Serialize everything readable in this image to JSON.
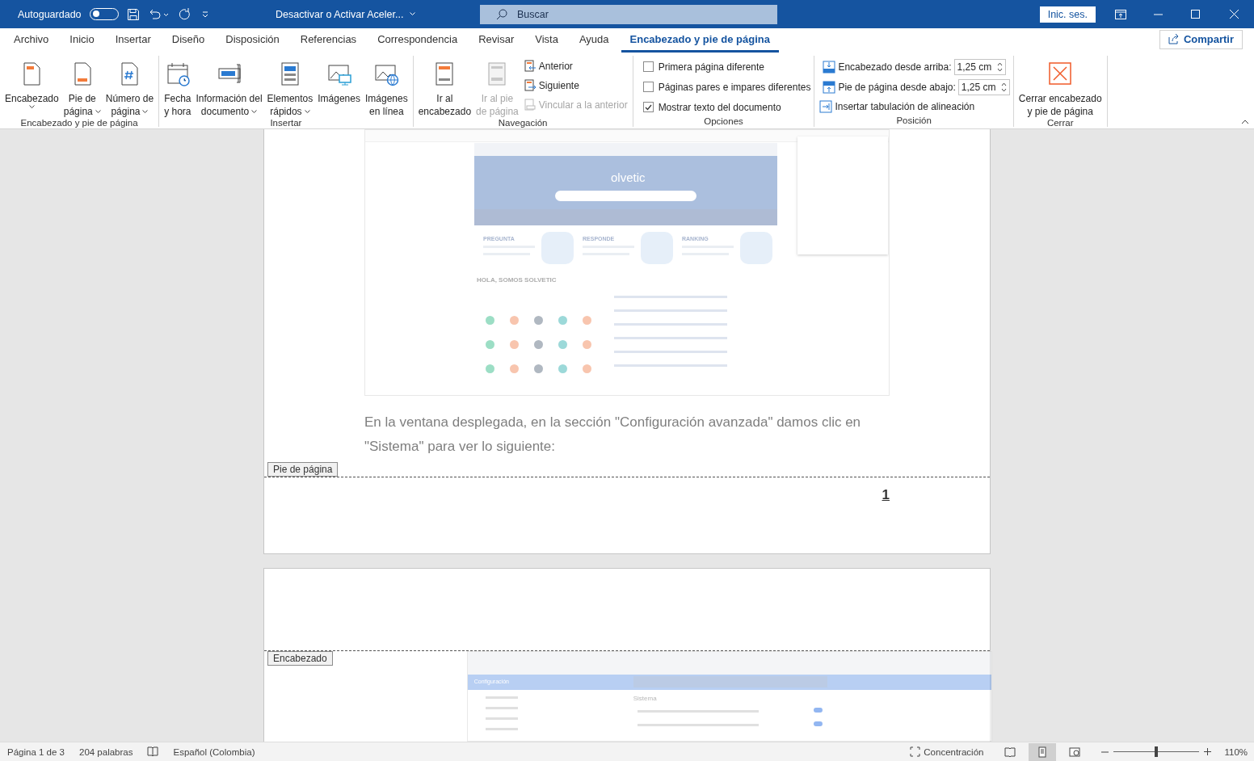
{
  "titlebar": {
    "autosave_label": "Autoguardado",
    "autosave_on": false,
    "doc_title": "Desactivar o Activar Aceler...",
    "search_placeholder": "Buscar",
    "signin": "Inic. ses."
  },
  "menu_tabs": [
    {
      "label": "Archivo",
      "selected": false
    },
    {
      "label": "Inicio",
      "selected": false
    },
    {
      "label": "Insertar",
      "selected": false
    },
    {
      "label": "Diseño",
      "selected": false
    },
    {
      "label": "Disposición",
      "selected": false
    },
    {
      "label": "Referencias",
      "selected": false
    },
    {
      "label": "Correspondencia",
      "selected": false
    },
    {
      "label": "Revisar",
      "selected": false
    },
    {
      "label": "Vista",
      "selected": false
    },
    {
      "label": "Ayuda",
      "selected": false
    },
    {
      "label": "Encabezado y pie de página",
      "selected": true
    }
  ],
  "share": "Compartir",
  "ribbon_groups": [
    {
      "title": "Encabezado y pie de página",
      "items": [
        {
          "kind": "large",
          "lines": [
            "Encabezado"
          ],
          "dropdown": true,
          "disabled": false
        },
        {
          "kind": "large",
          "lines": [
            "Pie de",
            "página"
          ],
          "dropdown": true,
          "disabled": false
        },
        {
          "kind": "large",
          "lines": [
            "Número de",
            "página"
          ],
          "dropdown": true,
          "disabled": false
        }
      ]
    },
    {
      "title": "Insertar",
      "items": [
        {
          "kind": "large",
          "lines": [
            "Fecha",
            "y hora"
          ],
          "dropdown": false,
          "disabled": false
        },
        {
          "kind": "large",
          "lines": [
            "Información del",
            "documento"
          ],
          "dropdown": true,
          "disabled": false
        },
        {
          "kind": "large",
          "lines": [
            "Elementos",
            "rápidos"
          ],
          "dropdown": true,
          "disabled": false
        },
        {
          "kind": "large",
          "lines": [
            "Imágenes"
          ],
          "dropdown": false,
          "disabled": false
        },
        {
          "kind": "large",
          "lines": [
            "Imágenes",
            "en línea"
          ],
          "dropdown": false,
          "disabled": false
        }
      ]
    },
    {
      "title": "Navegación",
      "items": [
        {
          "kind": "large",
          "lines": [
            "Ir al",
            "encabezado"
          ],
          "dropdown": false,
          "disabled": false
        },
        {
          "kind": "large",
          "lines": [
            "Ir al pie",
            "de página"
          ],
          "dropdown": false,
          "disabled": true
        },
        {
          "kind": "small",
          "label": "Anterior",
          "disabled": false
        },
        {
          "kind": "small",
          "label": "Siguiente",
          "disabled": false
        },
        {
          "kind": "small",
          "label": "Vincular a la anterior",
          "disabled": true
        }
      ]
    },
    {
      "title": "Opciones",
      "items": [
        {
          "kind": "checkbox",
          "label": "Primera página diferente",
          "checked": false
        },
        {
          "kind": "checkbox",
          "label": "Páginas pares e impares diferentes",
          "checked": false
        },
        {
          "kind": "checkbox",
          "label": "Mostrar texto del documento",
          "checked": true
        }
      ]
    },
    {
      "title": "Posición",
      "items": [
        {
          "kind": "spin",
          "label": "Encabezado desde arriba:",
          "value": "1,25 cm"
        },
        {
          "kind": "spin",
          "label": "Pie de página desde abajo:",
          "value": "1,25 cm"
        },
        {
          "kind": "small",
          "label": "Insertar tabulación de alineación",
          "disabled": false
        }
      ]
    },
    {
      "title": "Cerrar",
      "items": [
        {
          "kind": "large",
          "lines": [
            "Cerrar encabezado",
            "y pie de página"
          ],
          "dropdown": false,
          "disabled": false
        }
      ]
    }
  ],
  "document": {
    "page1": {
      "screenshot": {
        "brand": "olvetic",
        "cards": [
          "PREGUNTA",
          "RESPONDE",
          "RANKING"
        ],
        "intro": "HOLA, SOMOS SOLVETIC"
      },
      "paragraph": "En la ventana desplegada, en la sección \"Configuración avanzada\" damos clic en \"Sistema\" para ver lo siguiente:",
      "footer_tag": "Pie de página",
      "page_number": "1"
    },
    "page2": {
      "header_tag": "Encabezado",
      "screenshot": {
        "title": "Configuración",
        "section": "Sistema",
        "toggles": [
          {
            "on": true
          },
          {
            "on": true
          }
        ]
      }
    }
  },
  "statusbar": {
    "page": "Página 1 de 3",
    "words": "204 palabras",
    "language": "Español (Colombia)",
    "focus": "Concentración",
    "views": [
      {
        "kind": "read",
        "selected": false
      },
      {
        "kind": "print",
        "selected": true
      },
      {
        "kind": "web",
        "selected": false
      }
    ],
    "zoom": {
      "level": 0.5,
      "reading": "110%"
    }
  }
}
